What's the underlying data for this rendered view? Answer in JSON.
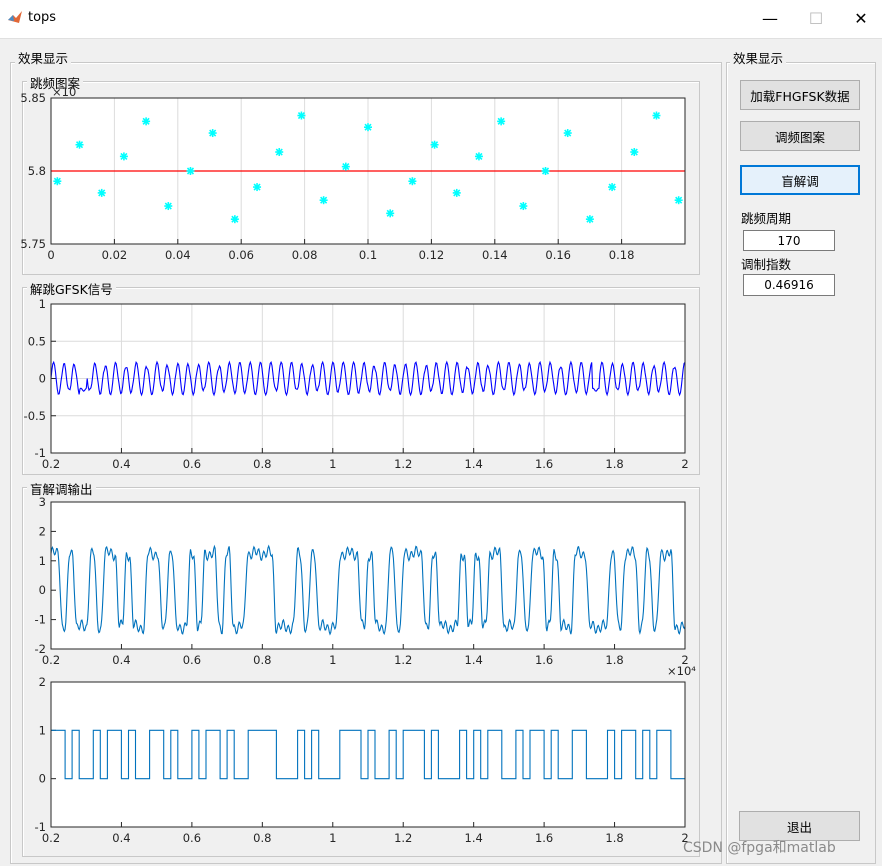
{
  "window": {
    "title": "tops",
    "minimize": "—",
    "maximize": "☐",
    "close": "✕"
  },
  "left_panel": {
    "title": "效果显示"
  },
  "right_panel": {
    "title": "效果显示"
  },
  "groups": {
    "hop": "跳频图案",
    "gfsk": "解跳GFSK信号",
    "demod": "盲解调输出"
  },
  "buttons": {
    "load": "加载FHGFSK数据",
    "pattern": "调频图案",
    "blind": "盲解调",
    "exit": "退出"
  },
  "params": {
    "period_label": "跳频周期",
    "period_value": "170",
    "index_label": "调制指数",
    "index_value": "0.46916"
  },
  "watermark": "CSDN @fpga和matlab",
  "colors": {
    "marker": "#00ffff",
    "redline": "#ff0000",
    "blue": "#0000ff",
    "mblue": "#0072bd",
    "grid": "#dcdcdc"
  },
  "chart_data": [
    {
      "type": "scatter",
      "name": "hop_pattern",
      "exponent_label": "×10",
      "xlim": [
        0,
        0.2
      ],
      "ylim": [
        5.75,
        5.85
      ],
      "xticks": [
        "0",
        "0.02",
        "0.04",
        "0.06",
        "0.08",
        "0.1",
        "0.12",
        "0.14",
        "0.16",
        "0.18"
      ],
      "yticks": [
        "5.75",
        "5.8",
        "5.85"
      ],
      "reference_y": 5.8,
      "points": [
        [
          0.002,
          5.793
        ],
        [
          0.009,
          5.818
        ],
        [
          0.016,
          5.785
        ],
        [
          0.023,
          5.81
        ],
        [
          0.03,
          5.834
        ],
        [
          0.037,
          5.776
        ],
        [
          0.044,
          5.8
        ],
        [
          0.051,
          5.826
        ],
        [
          0.058,
          5.767
        ],
        [
          0.065,
          5.789
        ],
        [
          0.072,
          5.813
        ],
        [
          0.079,
          5.838
        ],
        [
          0.086,
          5.78
        ],
        [
          0.093,
          5.803
        ],
        [
          0.1,
          5.83
        ],
        [
          0.107,
          5.771
        ],
        [
          0.114,
          5.793
        ],
        [
          0.121,
          5.818
        ],
        [
          0.128,
          5.785
        ],
        [
          0.135,
          5.81
        ],
        [
          0.142,
          5.834
        ],
        [
          0.149,
          5.776
        ],
        [
          0.156,
          5.8
        ],
        [
          0.163,
          5.826
        ],
        [
          0.17,
          5.767
        ],
        [
          0.177,
          5.789
        ],
        [
          0.184,
          5.813
        ],
        [
          0.191,
          5.838
        ],
        [
          0.198,
          5.78
        ]
      ]
    },
    {
      "type": "line",
      "name": "dehopped_gfsk",
      "xlim": [
        0.2,
        2
      ],
      "ylim": [
        -1,
        1
      ],
      "xticks": [
        "0.2",
        "0.4",
        "0.6",
        "0.8",
        "1",
        "1.2",
        "1.4",
        "1.6",
        "1.8",
        "2"
      ],
      "yticks": [
        "-1",
        "-0.5",
        "0",
        "0.5",
        "1"
      ],
      "bits": [
        1,
        1,
        0,
        1,
        0,
        0,
        1,
        0,
        1,
        1,
        0,
        1,
        0,
        0,
        1,
        1,
        0,
        1,
        0,
        0,
        1,
        0,
        1,
        1,
        0,
        1,
        0,
        0,
        1,
        1,
        1,
        1,
        0,
        0,
        0,
        1,
        0,
        1,
        0,
        0,
        0,
        1,
        1,
        1,
        0,
        1,
        0,
        0,
        1,
        0,
        1,
        1,
        1,
        0,
        1,
        0,
        0,
        0,
        1,
        0,
        1,
        0,
        1,
        1,
        0,
        0,
        1,
        0,
        1,
        1,
        0,
        1,
        0,
        0,
        1,
        1,
        0,
        0,
        0,
        1,
        0,
        1,
        1,
        0,
        1,
        0,
        1,
        1,
        0,
        0
      ],
      "amplitude": 0.22
    },
    {
      "type": "line",
      "name": "blind_demod_output",
      "exponent_label": "×10⁴",
      "xlim": [
        0.2,
        2
      ],
      "ylim": [
        -2,
        3
      ],
      "xticks": [
        "0.2",
        "0.4",
        "0.6",
        "0.8",
        "1",
        "1.2",
        "1.4",
        "1.6",
        "1.8",
        "2"
      ],
      "yticks": [
        "-2",
        "-1",
        "0",
        "1",
        "2",
        "3"
      ],
      "amplitude": 1.25
    },
    {
      "type": "line",
      "name": "decided_bits",
      "xlim": [
        0.2,
        2
      ],
      "ylim": [
        -1,
        2
      ],
      "xticks": [
        "0.2",
        "0.4",
        "0.6",
        "0.8",
        "1",
        "1.2",
        "1.4",
        "1.6",
        "1.8",
        "2"
      ],
      "yticks": [
        "-1",
        "0",
        "1",
        "2"
      ]
    }
  ]
}
